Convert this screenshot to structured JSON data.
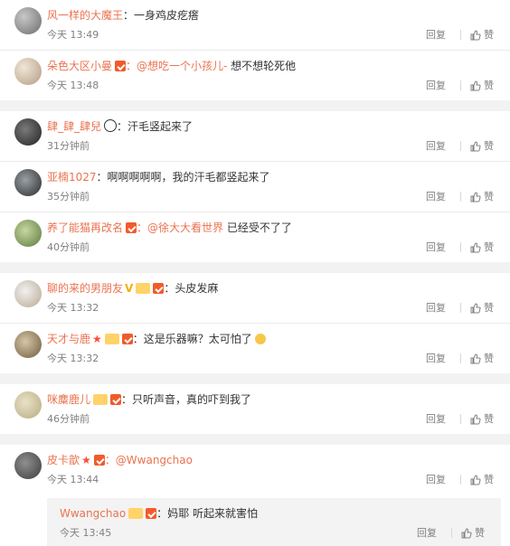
{
  "labels": {
    "reply": "回复",
    "like": "赞"
  },
  "groups": [
    {
      "comments": [
        {
          "name": "风一样的大魔王",
          "text": "：一身鸡皮疙瘩",
          "time": "今天 13:49"
        },
        {
          "name": "朵色大区小曼",
          "mention": "：@想吃一个小孩儿-",
          "text": " 想不想轮死他",
          "time": "今天 13:48"
        }
      ]
    },
    {
      "comments": [
        {
          "name": "肆_肆_肆兒",
          "text": "：汗毛竖起来了",
          "time": "31分钟前"
        },
        {
          "name": "亚楠1027",
          "text": "：啊啊啊啊啊，我的汗毛都竖起来了",
          "time": "35分钟前"
        },
        {
          "name": "养了能猫再改名",
          "mention": "：@徐大大看世界",
          "text": " 已经受不了了",
          "time": "40分钟前"
        }
      ]
    },
    {
      "comments": [
        {
          "name": "聊的来的男朋友",
          "text": "：头皮发麻",
          "time": "今天 13:32"
        },
        {
          "name": "天才与鹿",
          "text": "：这是乐器嘛？太可怕了",
          "time": "今天 13:32"
        }
      ]
    },
    {
      "comments": [
        {
          "name": "咪麋鹿儿",
          "text": "：只听声音，真的吓到我了",
          "time": "46分钟前"
        }
      ]
    },
    {
      "comments": [
        {
          "name": "皮卡歆",
          "text": "：@Wwangchao",
          "time": "今天 13:44"
        }
      ],
      "subreply": {
        "name": "Wwangchao",
        "text": "：妈耶 听起来就害怕",
        "time": "今天 13:45"
      }
    }
  ]
}
